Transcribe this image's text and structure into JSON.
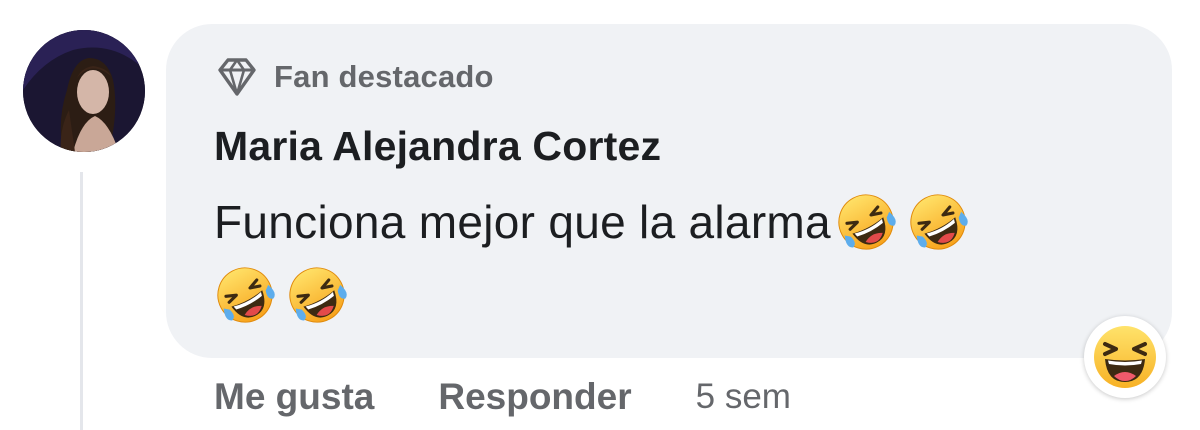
{
  "comment": {
    "badge_label": "Fan destacado",
    "badge_icon": "diamond-icon",
    "author_name": "Maria Alejandra Cortez",
    "text": "Funciona mejor que la alarma",
    "emojis": [
      "rolling-on-floor-laughing",
      "rolling-on-floor-laughing",
      "rolling-on-floor-laughing",
      "rolling-on-floor-laughing"
    ],
    "reaction": "haha-reaction-icon",
    "actions": {
      "like_label": "Me gusta",
      "reply_label": "Responder",
      "timestamp": "5 sem"
    }
  },
  "colors": {
    "bubble_background": "#f0f2f5",
    "secondary_text": "#65676b",
    "primary_text": "#1c1e21",
    "emoji_yellow": "#ffcc4d",
    "emoji_orange": "#f4900c"
  }
}
